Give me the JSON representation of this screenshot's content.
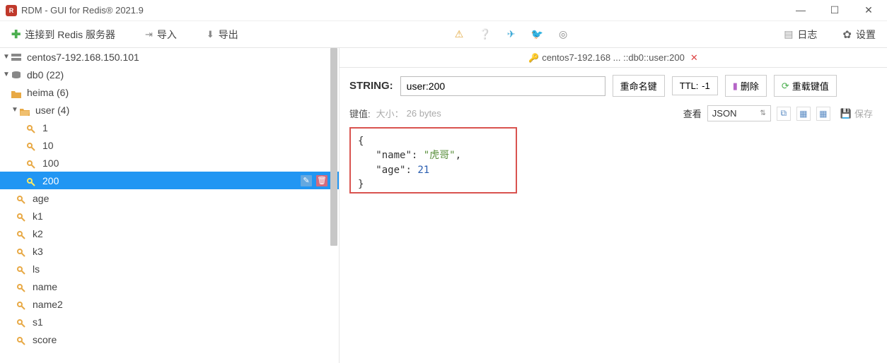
{
  "titlebar": {
    "app": "RDM - GUI for Redis® 2021.9"
  },
  "toolbar": {
    "connect": "连接到 Redis 服务器",
    "import": "导入",
    "export": "导出",
    "log": "日志",
    "settings": "设置"
  },
  "tree": {
    "server": "centos7-192.168.150.101",
    "db": "db0  (22)",
    "folders": [
      {
        "name": "heima (6)",
        "expanded": false
      },
      {
        "name": "user (4)",
        "expanded": true,
        "keys": [
          "1",
          "10",
          "100",
          "200"
        ]
      }
    ],
    "keys": [
      "age",
      "k1",
      "k2",
      "k3",
      "ls",
      "name",
      "name2",
      "s1",
      "score"
    ],
    "selected": "200"
  },
  "tab": {
    "title": "centos7-192.168 ... ::db0::user:200"
  },
  "key": {
    "type": "STRING:",
    "name": "user:200",
    "rename": "重命名键",
    "ttl_label": "TTL:",
    "ttl_value": "-1",
    "delete": "删除",
    "reload": "重载键值"
  },
  "value": {
    "label": "键值:",
    "size_prefix": "大小：",
    "size": "26 bytes",
    "view": "查看",
    "format": "JSON",
    "save": "保存"
  },
  "json": {
    "kname": "\"name\"",
    "vname": "\"虎哥\"",
    "kage": "\"age\"",
    "vage": "21"
  }
}
